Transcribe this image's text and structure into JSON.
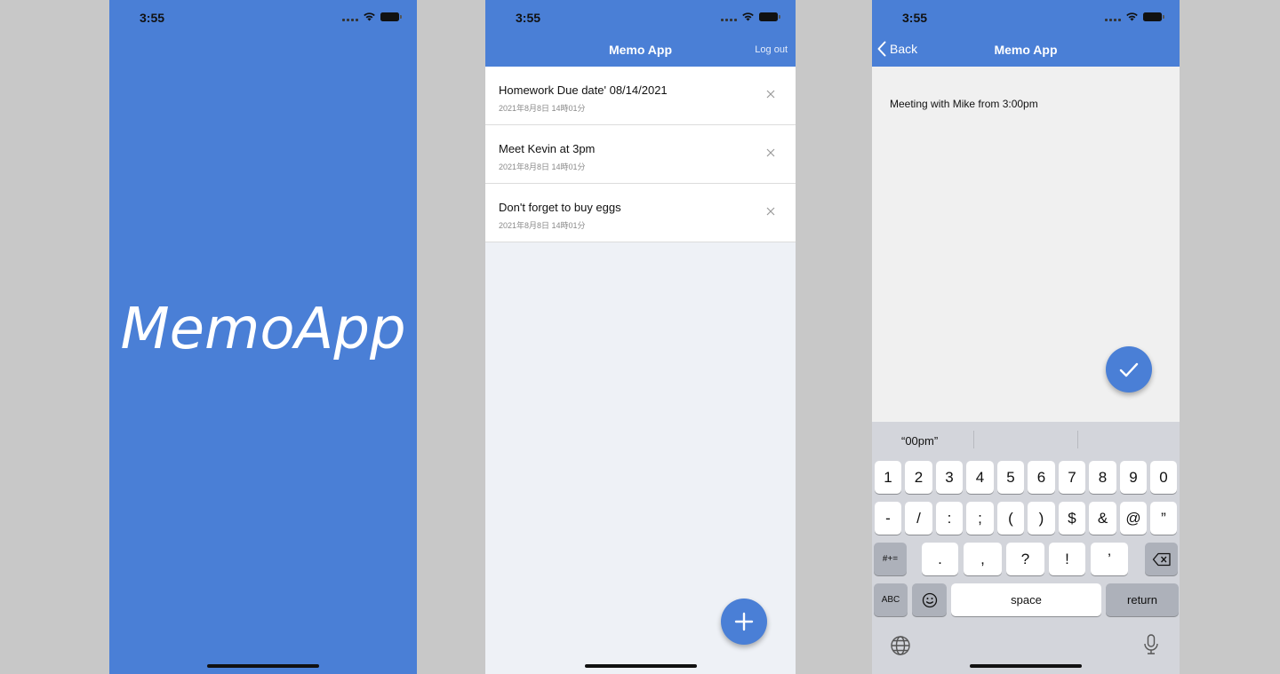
{
  "colors": {
    "brand": "#4a7fd6",
    "list_bg": "#eef1f6",
    "editor_bg": "#f0f0f0",
    "keyboard_bg": "#d3d5db"
  },
  "status_bar": {
    "time": "3:55"
  },
  "splash": {
    "logo_text": "MemoApp"
  },
  "list_screen": {
    "title": "Memo App",
    "logout_label": "Log out",
    "memos": [
      {
        "title": "Homework Due date' 08/14/2021",
        "date": "2021年8月8日 14時01分"
      },
      {
        "title": "Meet Kevin at 3pm",
        "date": "2021年8月8日 14時01分"
      },
      {
        "title": "Don't forget to buy eggs",
        "date": "2021年8月8日 14時01分"
      }
    ],
    "fab_icon": "plus-icon"
  },
  "edit_screen": {
    "back_label": "Back",
    "title": "Memo App",
    "body_text": "Meeting with Mike from 3:00pm",
    "fab_icon": "check-icon"
  },
  "keyboard": {
    "suggestion": "“00pm”",
    "row1": [
      "1",
      "2",
      "3",
      "4",
      "5",
      "6",
      "7",
      "8",
      "9",
      "0"
    ],
    "row2": [
      "-",
      "/",
      ":",
      ";",
      "(",
      ")",
      "$",
      "&",
      "@",
      "”"
    ],
    "row3": [
      ".",
      ",",
      "?",
      "!",
      "’"
    ],
    "symbols_key": "#+=",
    "abc_key": "ABC",
    "space_key": "space",
    "return_key": "return"
  }
}
